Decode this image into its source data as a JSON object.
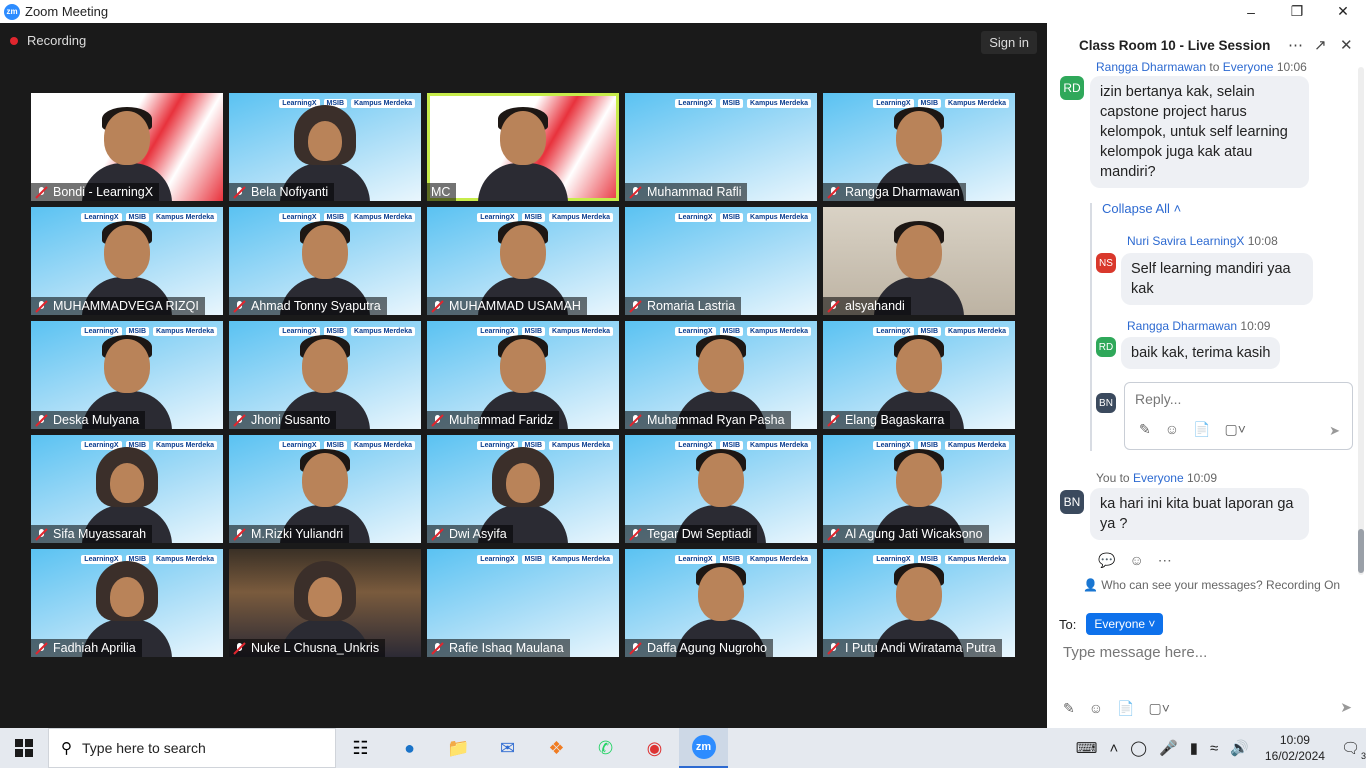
{
  "window": {
    "title": "Zoom Meeting",
    "logo_text": "zm"
  },
  "meeting": {
    "recording_label": "Recording",
    "signin_label": "Sign in",
    "participants": [
      {
        "name": "Bondi - LearningX",
        "style": "red"
      },
      {
        "name": "Bela Nofiyanti",
        "style": "blue",
        "hijab": true
      },
      {
        "name": "MC",
        "style": "red",
        "active": true
      },
      {
        "name": "Muhammad Rafli",
        "style": "blue",
        "empty": true
      },
      {
        "name": "Rangga Dharmawan",
        "style": "blue"
      },
      {
        "name": "MUHAMMADVEGA RIZQI",
        "style": "blue"
      },
      {
        "name": "Ahmad Tonny Syaputra",
        "style": "blue"
      },
      {
        "name": "MUHAMMAD USAMAH",
        "style": "blue"
      },
      {
        "name": "Romaria Lastria",
        "style": "blue",
        "empty": true
      },
      {
        "name": "alsyahandi",
        "style": "room"
      },
      {
        "name": "Deska Mulyana",
        "style": "blue"
      },
      {
        "name": "Jhoni Susanto",
        "style": "blue"
      },
      {
        "name": "Muhammad Faridz",
        "style": "blue"
      },
      {
        "name": "Muhammad Ryan Pasha",
        "style": "blue"
      },
      {
        "name": "Elang Bagaskarra",
        "style": "blue"
      },
      {
        "name": "Sifa Muyassarah",
        "style": "blue",
        "hijab": true
      },
      {
        "name": "M.Rizki Yuliandri",
        "style": "blue"
      },
      {
        "name": "Dwi Asyifa",
        "style": "blue",
        "hijab": true
      },
      {
        "name": "Tegar Dwi Septiadi",
        "style": "blue"
      },
      {
        "name": "Al Agung Jati Wicaksono",
        "style": "blue"
      },
      {
        "name": "Fadhiah Aprilia",
        "style": "blue",
        "hijab": true
      },
      {
        "name": "Nuke L Chusna_Unkris",
        "style": "dark",
        "hijab": true
      },
      {
        "name": "Rafie Ishaq Maulana",
        "style": "blue",
        "empty": true
      },
      {
        "name": "Daffa Agung Nugroho",
        "style": "blue"
      },
      {
        "name": "I Putu Andi Wiratama Putra",
        "style": "blue"
      }
    ],
    "banner": [
      "LearningX",
      "MSIB",
      "Kampus Merdeka"
    ]
  },
  "chat": {
    "title": "Class Room 10 - Live Session",
    "top_meta": {
      "name": "Rangga Dharmawan",
      "to": "to",
      "recipient": "Everyone",
      "time": "10:06"
    },
    "top_avatar": "RD",
    "top_message": "izin bertanya kak, selain capstone project harus kelompok, untuk self learning kelompok juga kak atau mandiri?",
    "collapse_label": "Collapse All",
    "replies": [
      {
        "avatar": "NS",
        "color": "#d9382c",
        "name": "Nuri Savira LearningX",
        "time": "10:08",
        "text": "Self learning mandiri yaa kak"
      },
      {
        "avatar": "RD",
        "color": "#2fa85a",
        "name": "Rangga Dharmawan",
        "time": "10:09",
        "text": "baik kak, terima kasih"
      }
    ],
    "reply_avatar": "BN",
    "reply_placeholder": "Reply...",
    "my_meta": {
      "you": "You to",
      "recipient": "Everyone",
      "time": "10:09"
    },
    "my_avatar": "BN",
    "my_message": "ka hari ini kita buat laporan ga ya ?",
    "who_can_see": "Who can see your messages? Recording On",
    "to_label": "To:",
    "to_value": "Everyone",
    "input_placeholder": "Type message here..."
  },
  "taskbar": {
    "search_placeholder": "Type here to search",
    "time": "10:09",
    "date": "16/02/2024",
    "notification_count": "3"
  }
}
